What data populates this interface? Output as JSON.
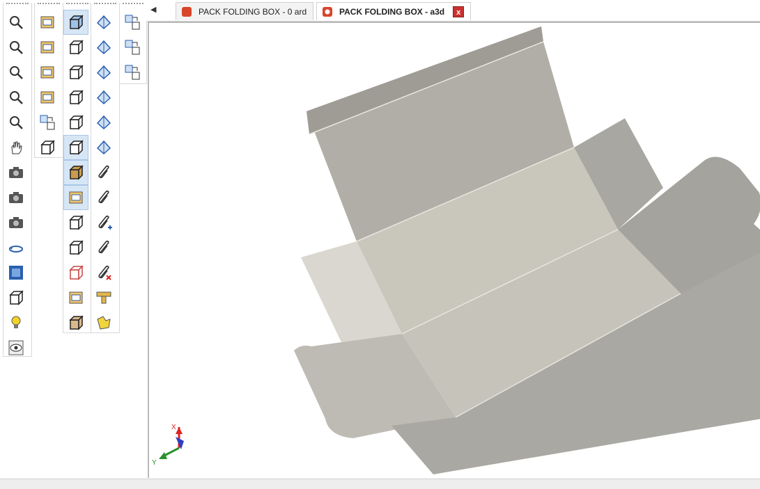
{
  "tabs": [
    {
      "label": "PACK FOLDING BOX - 0 ard",
      "icon": "ard-document-icon",
      "active": false
    },
    {
      "label": "PACK FOLDING BOX - a3d",
      "icon": "a3d-document-icon",
      "active": true
    }
  ],
  "close_label": "x",
  "scroll_left_glyph": "◀",
  "axis": {
    "x": "X",
    "y": "Y"
  },
  "toolbar_col1": [
    "zoom-in-icon",
    "zoom-window-icon",
    "zoom-out-icon",
    "zoom-dynamic-icon",
    "zoom-extents-icon",
    "pan-hand-icon",
    "camera-icon",
    "camera-previous-icon",
    "camera-next-icon",
    "rotate-view-icon",
    "front-view-icon",
    "iso-view-icon",
    "light-bulb-icon",
    "visibility-eye-icon"
  ],
  "toolbar_col2": [
    "open-box-icon",
    "layers-icon",
    "wireframe-edit-icon",
    "pallet-icon",
    "export-view-icon",
    "board-insert-icon"
  ],
  "toolbar_col3": [
    "shaded-cube-icon",
    "solid-cube-icon",
    "outline-cube-icon",
    "hidden-line-cube-icon",
    "wire-cube-icon",
    "bevel-board-icon",
    "corrugated-board-icon",
    "texture-icon",
    "edges-cube-icon",
    "transparent-cube-icon",
    "red-wire-cube-icon",
    "dark-shade-icon",
    "texture-board-icon"
  ],
  "toolbar_col4": [
    "fold-direction-icon",
    "fold-panel-icon",
    "unfold-icon",
    "fold-all-icon",
    "measure-icon",
    "bend-icon",
    "clip-icon",
    "clip-edit-icon",
    "clip-add-icon",
    "clip-scissors-icon",
    "clip-delete-icon",
    "stand-icon",
    "shape-icon"
  ],
  "toolbar_col5": [
    "copy-view-icon",
    "paste-view-icon",
    "sync-view-icon"
  ],
  "colors": {
    "panel_light": "#c9c6bc",
    "panel_mid": "#b3b1aa",
    "panel_dark": "#9d9c96",
    "flap": "#dedcd4",
    "accent_active": "#d7e6f5"
  }
}
